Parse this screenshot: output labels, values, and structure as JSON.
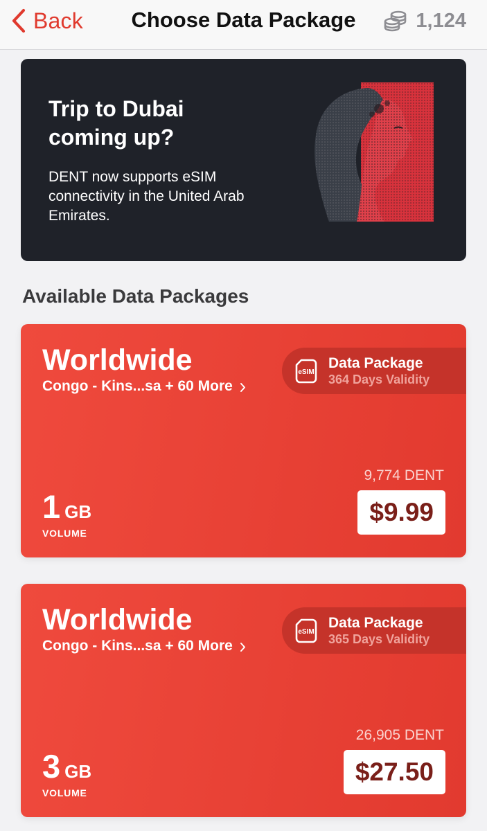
{
  "nav": {
    "back_label": "Back",
    "title": "Choose Data Package",
    "balance": "1,124",
    "back_icon": "chevron-left-icon",
    "balance_icon": "coins-icon"
  },
  "promo": {
    "title_line1": "Trip to Dubai",
    "title_line2": "coming up?",
    "body": "DENT now supports eSIM connectivity in the United Arab Emirates.",
    "image_icon": "woman-portrait-illustration"
  },
  "section": {
    "heading": "Available Data Packages"
  },
  "packages": [
    {
      "region": "Worldwide",
      "countries": "Congo - Kins...sa + 60 More",
      "tag_title": "Data Package",
      "tag_validity": "364 Days Validity",
      "volume": "1",
      "volume_unit": "GB",
      "volume_label": "VOLUME",
      "dent_price": "9,774 DENT",
      "price": "$9.99"
    },
    {
      "region": "Worldwide",
      "countries": "Congo - Kins...sa + 60 More",
      "tag_title": "Data Package",
      "tag_validity": "365 Days Validity",
      "volume": "3",
      "volume_unit": "GB",
      "volume_label": "VOLUME",
      "dent_price": "26,905 DENT",
      "price": "$27.50"
    }
  ],
  "colors": {
    "accent": "#e03a2e",
    "card_red": "#ea4236",
    "banner_bg": "#1f2229",
    "price_text": "#7a1f19"
  }
}
